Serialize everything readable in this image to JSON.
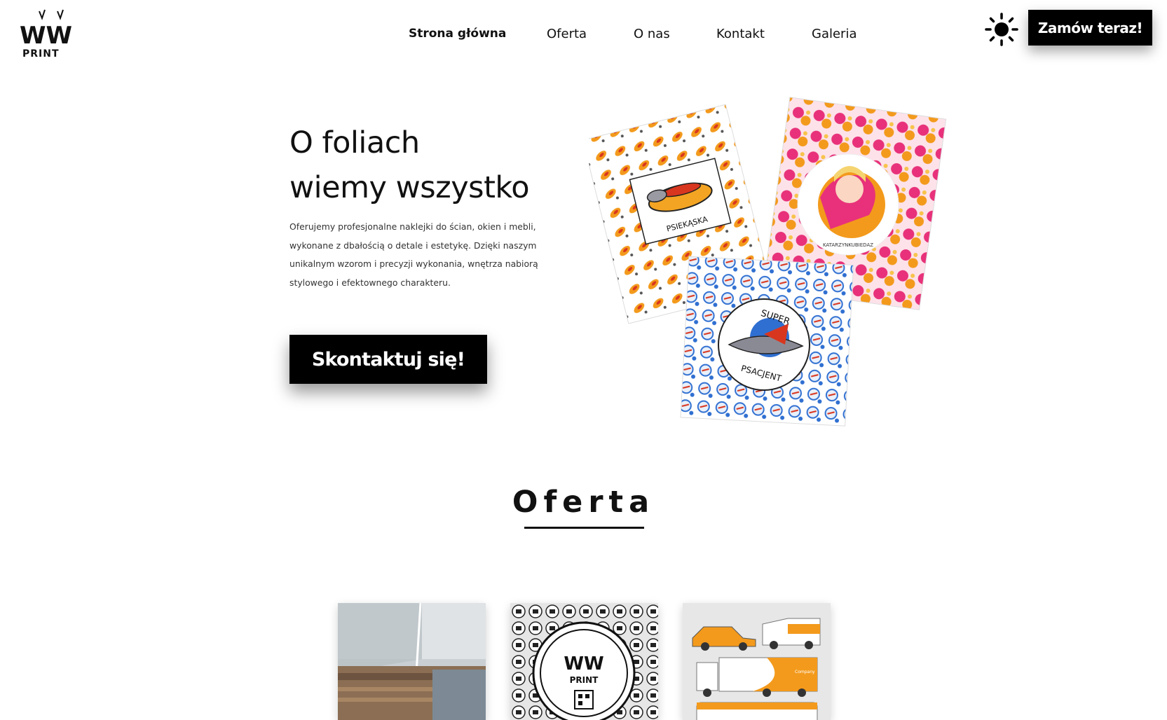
{
  "header": {
    "logo_text_top": "WW",
    "logo_text_bottom": "PRINT",
    "nav": [
      {
        "label": "Strona główna",
        "active": true
      },
      {
        "label": "Oferta",
        "active": false
      },
      {
        "label": "O nas",
        "active": false
      },
      {
        "label": "Kontakt",
        "active": false
      },
      {
        "label": "Galeria",
        "active": false
      }
    ],
    "theme_icon": "sun-icon",
    "order_button": "Zamów teraz!"
  },
  "hero": {
    "title_line1": "O foliach",
    "title_line2": "wiemy wszystko",
    "description": "Oferujemy profesjonalne naklejki do ścian, okien i mebli, wykonane z dbałością o detale i estetykę. Dzięki naszym unikalnym wzorom i precyzji wykonania, wnętrza nabiorą stylowego i efektownego charakteru.",
    "cta_button": "Skontaktuj się!",
    "stickers": {
      "sticker1_text": "PSIEKĄSKA",
      "sticker2_text": "KATARZYNKUBIEDAZ",
      "sticker3_text_top": "SUPER",
      "sticker3_text_bottom": "PSACJENT"
    }
  },
  "offer": {
    "section_title": "Oferta",
    "cards": [
      {
        "name": "window-film"
      },
      {
        "name": "logo-stickers",
        "logo_top": "WW",
        "logo_bottom": "PRINT"
      },
      {
        "name": "vehicle-branding",
        "van_text": "Company"
      }
    ]
  },
  "colors": {
    "primary": "#000000",
    "background": "#ffffff",
    "accent_orange": "#f39a1c",
    "accent_pink": "#e8317a",
    "accent_blue": "#2f6fd1"
  }
}
